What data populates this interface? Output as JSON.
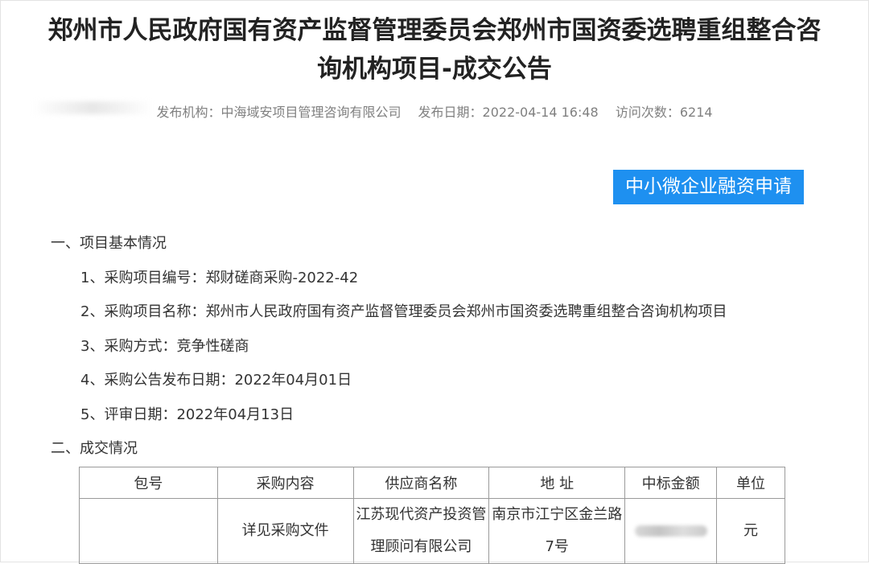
{
  "article": {
    "title_line1": "郑州市人民政府国有资产监督管理委员会郑州市国资委选聘重组整合咨",
    "title_line2": "询机构项目-成交公告",
    "meta": {
      "publisher": "发布机构：中海域安项目管理咨询有限公司",
      "date": "发布日期：2022-04-14 16:48",
      "visits": "访问次数：6214"
    },
    "finance_button": "中小微企业融资申请"
  },
  "section1": {
    "heading": "一、项目基本情况",
    "items": [
      "1、采购项目编号：郑财磋商采购-2022-42",
      "2、采购项目名称：郑州市人民政府国有资产监督管理委员会郑州市国资委选聘重组整合咨询机构项目",
      "3、采购方式：竞争性磋商",
      "4、采购公告发布日期：2022年04月01日",
      "5、评审日期：2022年04月13日"
    ]
  },
  "section2": {
    "heading": "二、成交情况",
    "table": {
      "headers": [
        "包号",
        "采购内容",
        "供应商名称",
        "地 址",
        "中标金额",
        "单位"
      ],
      "row": {
        "package": "",
        "content": "详见采购文件",
        "supplier": "江苏现代资产投资管理顾问有限公司",
        "address": "南京市江宁区金兰路7号",
        "amount": "",
        "unit": "元"
      }
    }
  },
  "colors": {
    "accent": "#1e90f0",
    "text": "#333333",
    "meta": "#808080",
    "border": "#9a9a9a"
  }
}
